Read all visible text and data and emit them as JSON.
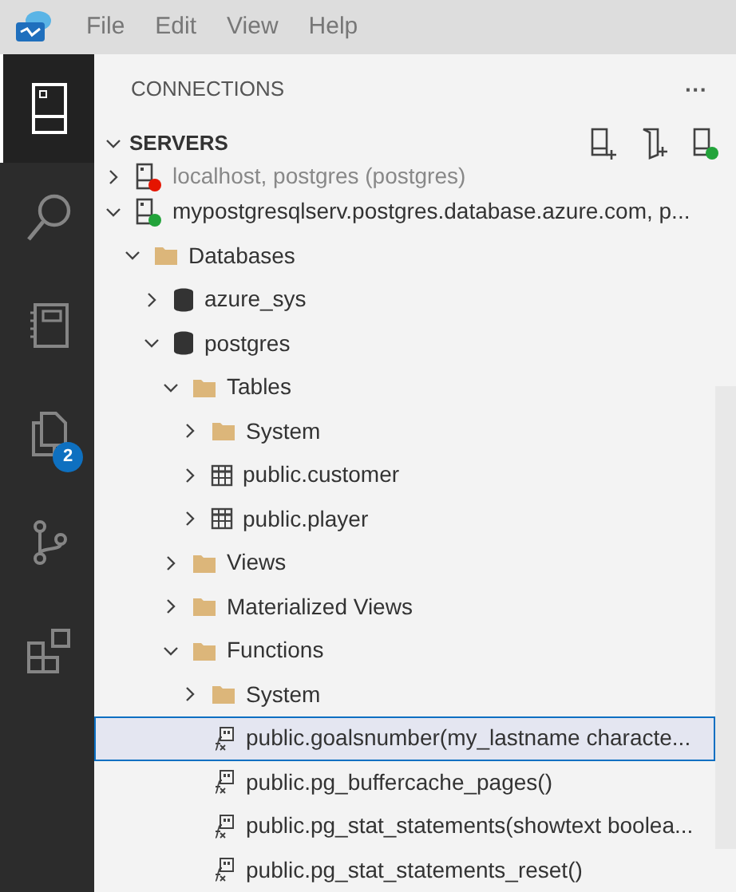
{
  "menu": [
    "File",
    "Edit",
    "View",
    "Help"
  ],
  "activity_bar": [
    {
      "kind": "servers",
      "selected": true
    },
    {
      "kind": "search",
      "selected": false
    },
    {
      "kind": "notebook",
      "selected": false
    },
    {
      "kind": "files",
      "selected": false,
      "badge": "2"
    },
    {
      "kind": "branch",
      "selected": false
    },
    {
      "kind": "extensions",
      "selected": false
    }
  ],
  "panel": {
    "title": "CONNECTIONS",
    "more": "···",
    "section": "SERVERS",
    "section_expanded": true
  },
  "tree": [
    {
      "kind": "server",
      "label": "localhost, postgres (postgres)",
      "color": "#e51400",
      "expanded": false,
      "selected": false,
      "compact": true
    },
    {
      "kind": "server",
      "label": "mypostgresqlserv.postgres.database.azure.com, p...",
      "color": "#22a33a",
      "expanded": true,
      "selected": false,
      "children": [
        {
          "kind": "folder",
          "label": "Databases",
          "expanded": true,
          "selected": false,
          "children": [
            {
              "kind": "database",
              "label": "azure_sys",
              "expanded": false,
              "selected": false
            },
            {
              "kind": "database",
              "label": "postgres",
              "expanded": true,
              "selected": false,
              "children": [
                {
                  "kind": "folder",
                  "label": "Tables",
                  "expanded": true,
                  "selected": false,
                  "children": [
                    {
                      "kind": "folder",
                      "label": "System",
                      "expanded": false,
                      "selected": false
                    },
                    {
                      "kind": "table",
                      "label": "public.customer",
                      "expanded": false,
                      "selected": false
                    },
                    {
                      "kind": "table",
                      "label": "public.player",
                      "expanded": false,
                      "selected": false
                    }
                  ]
                },
                {
                  "kind": "folder",
                  "label": "Views",
                  "expanded": false,
                  "selected": false
                },
                {
                  "kind": "folder",
                  "label": "Materialized Views",
                  "expanded": false,
                  "selected": false
                },
                {
                  "kind": "folder",
                  "label": "Functions",
                  "expanded": true,
                  "selected": false,
                  "children": [
                    {
                      "kind": "folder",
                      "label": "System",
                      "expanded": false,
                      "selected": false
                    },
                    {
                      "kind": "function",
                      "label": "public.goalsnumber(my_lastname characte...",
                      "selected": true
                    },
                    {
                      "kind": "function",
                      "label": "public.pg_buffercache_pages()",
                      "selected": false
                    },
                    {
                      "kind": "function",
                      "label": "public.pg_stat_statements(showtext boolea...",
                      "selected": false
                    },
                    {
                      "kind": "function",
                      "label": "public.pg_stat_statements_reset()",
                      "selected": false
                    }
                  ]
                }
              ]
            }
          ]
        }
      ]
    }
  ]
}
